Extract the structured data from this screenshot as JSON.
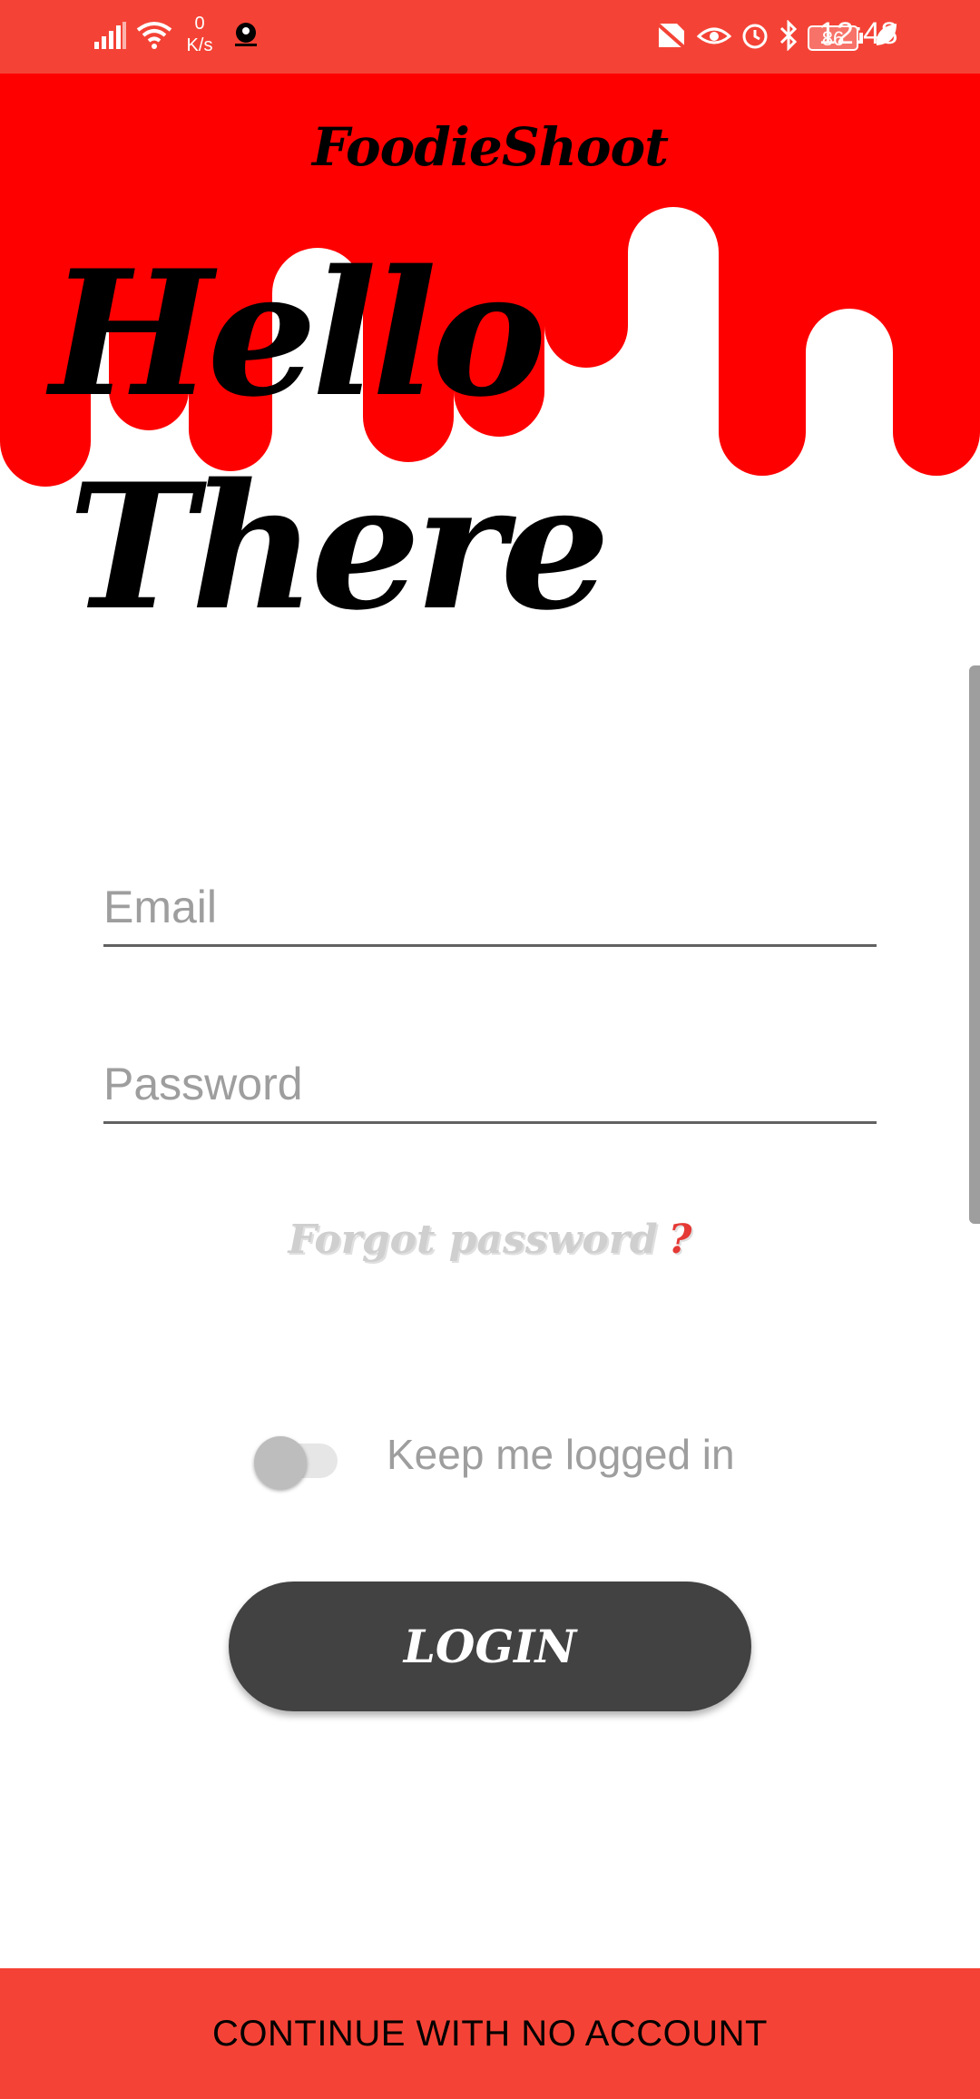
{
  "status_bar": {
    "net_speed_value": "0",
    "net_speed_unit": "K/s",
    "battery": "86",
    "time": "12:48",
    "icons": [
      "signal-icon",
      "wifi-icon",
      "app-notification-icon",
      "no-sim-icon",
      "eye-icon",
      "alarm-icon",
      "bluetooth-icon",
      "battery-icon",
      "leaf-icon"
    ]
  },
  "header": {
    "brand": "FoodieShoot",
    "greeting_line1": "Hello",
    "greeting_line2": "There"
  },
  "form": {
    "email_placeholder": "Email",
    "email_value": "",
    "password_placeholder": "Password",
    "password_value": "",
    "forgot_label": "Forgot password",
    "forgot_mark": "?",
    "keep_logged_in_label": "Keep me logged in",
    "keep_logged_in": false,
    "login_label": "LOGIN"
  },
  "footer": {
    "continue_label": "CONTINUE WITH NO ACCOUNT"
  },
  "colors": {
    "accent": "#f44336",
    "drip": "#ff0000",
    "button": "#424242"
  }
}
